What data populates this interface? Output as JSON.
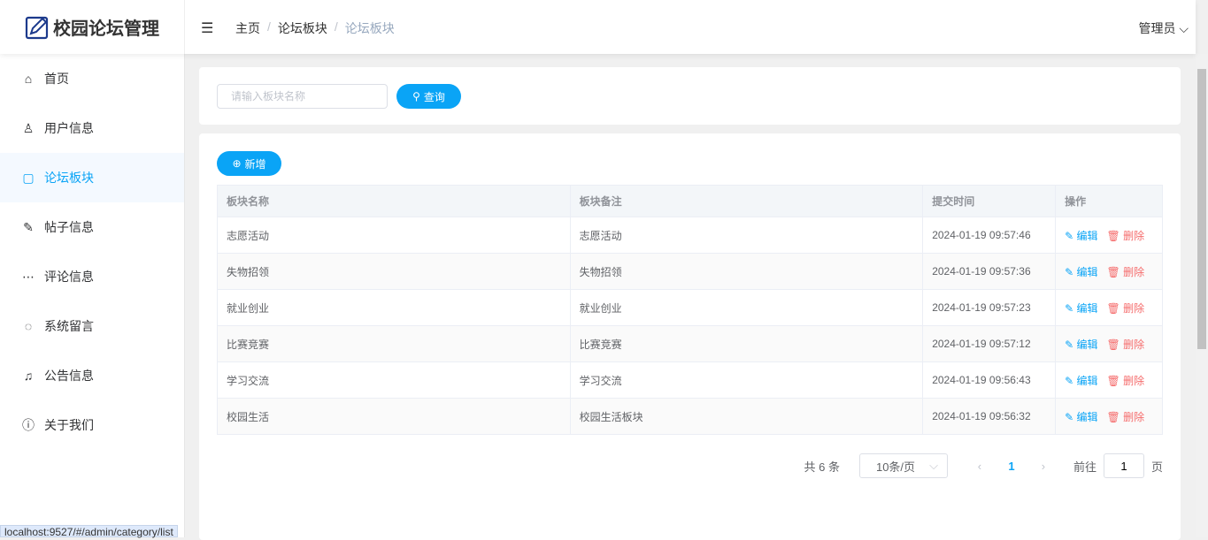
{
  "app": {
    "title": "校园论坛管理"
  },
  "header": {
    "breadcrumb": [
      "主页",
      "论坛板块",
      "论坛板块"
    ],
    "user": "管理员"
  },
  "sidebar": {
    "items": [
      {
        "label": "首页",
        "icon": "home-icon"
      },
      {
        "label": "用户信息",
        "icon": "user-icon"
      },
      {
        "label": "论坛板块",
        "icon": "category-icon"
      },
      {
        "label": "帖子信息",
        "icon": "edit-icon"
      },
      {
        "label": "评论信息",
        "icon": "comment-icon"
      },
      {
        "label": "系统留言",
        "icon": "message-icon"
      },
      {
        "label": "公告信息",
        "icon": "bell-icon"
      },
      {
        "label": "关于我们",
        "icon": "info-icon"
      }
    ]
  },
  "search": {
    "placeholder": "请输入板块名称",
    "button": "查询"
  },
  "toolbar": {
    "add": "新增"
  },
  "table": {
    "headers": [
      "板块名称",
      "板块备注",
      "提交时间",
      "操作"
    ],
    "rows": [
      [
        "志愿活动",
        "志愿活动",
        "2024-01-19 09:57:46"
      ],
      [
        "失物招领",
        "失物招领",
        "2024-01-19 09:57:36"
      ],
      [
        "就业创业",
        "就业创业",
        "2024-01-19 09:57:23"
      ],
      [
        "比赛竞赛",
        "比赛竞赛",
        "2024-01-19 09:57:12"
      ],
      [
        "学习交流",
        "学习交流",
        "2024-01-19 09:56:43"
      ],
      [
        "校园生活",
        "校园生活板块",
        "2024-01-19 09:56:32"
      ]
    ],
    "edit": "编辑",
    "delete": "删除"
  },
  "pagination": {
    "total": "共 6 条",
    "size": "10条/页",
    "current": "1",
    "goto": "前往",
    "page_value": "1",
    "page_suffix": "页"
  },
  "status_url": "localhost:9527/#/admin/category/list"
}
